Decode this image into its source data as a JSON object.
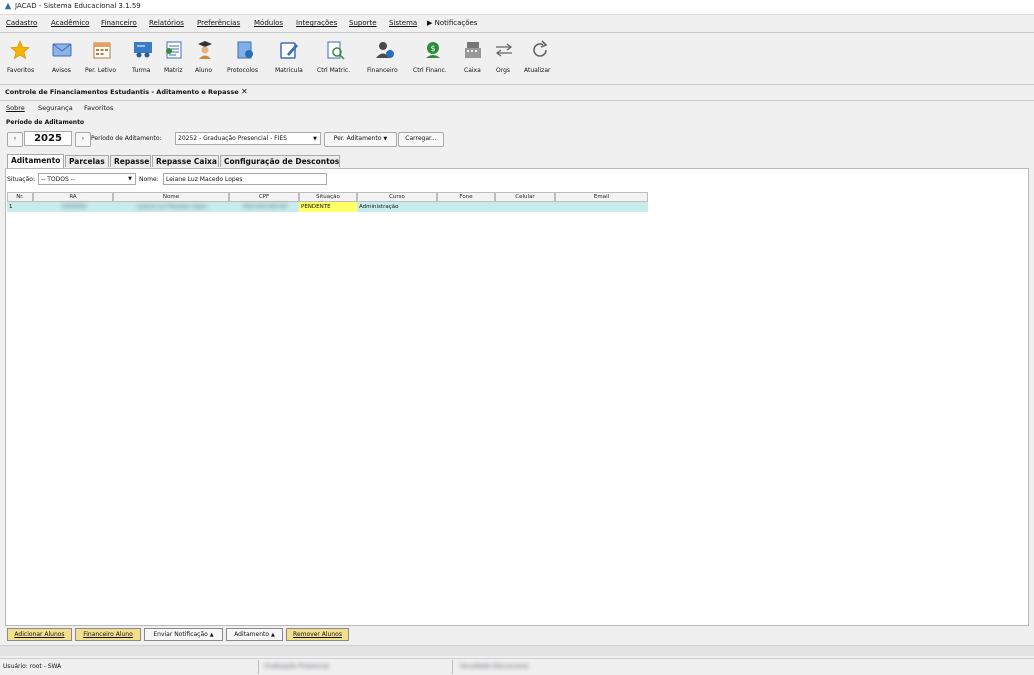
{
  "window": {
    "title": "JACAD - Sistema Educacional 3.1.59"
  },
  "menubar": {
    "items": [
      "Cadastro",
      "Acadêmico",
      "Financeiro",
      "Relatórios",
      "Preferências",
      "Módulos",
      "Integrações",
      "Suporte",
      "Sistema",
      "Notificações"
    ]
  },
  "toolbar": {
    "items": [
      "Favoritos",
      "Avisos",
      "Per. Letivo",
      "Turma",
      "Matriz",
      "Aluno",
      "Protocolos",
      "Matricula",
      "Ctrl Matric.",
      "Financeiro",
      "Ctrl Financ.",
      "Caixa",
      "Orgs",
      "Atualizar"
    ]
  },
  "main_tab": {
    "title": "Controle de Financiamentos Estudantis - Aditamento e Repasse",
    "close": "✕"
  },
  "submenu": {
    "items": [
      "Sobre",
      "Segurança",
      "Favoritos"
    ]
  },
  "period": {
    "label": "Período de Aditamento",
    "prev": "‹",
    "year": "2025",
    "next": "›",
    "periodo_label": "Período de Aditamento:",
    "periodo_value": "20252 - Graduação Presencial - FIES",
    "per_button": "Per. Aditamento",
    "carregar": "Carregar..."
  },
  "tabs": [
    "Aditamento",
    "Parcelas",
    "Repasse",
    "Repasse Caixa",
    "Configuração de Descontos"
  ],
  "filters": {
    "situacao_label": "Situação:",
    "situacao_value": "-- TODOS --",
    "nome_label": "Nome:",
    "nome_value": "Leiane Luz Macedo Lopes"
  },
  "grid": {
    "columns": [
      "Nr.",
      "RA",
      "Nome",
      "CPF",
      "Situação",
      "Curso",
      "Fone",
      "Celular",
      "Email"
    ],
    "rows": [
      {
        "nr": "1",
        "ra": "0000000",
        "nome": "Leiane Luz Macedo Lopes",
        "cpf": "000.000.000-00",
        "situacao": "PENDENTE",
        "curso": "Administração",
        "fone": "",
        "celular": "",
        "email": ""
      }
    ]
  },
  "bottom_buttons": [
    "Adicionar Alunos",
    "Financeiro Aluno",
    "Enviar Notificação",
    "Aditamento",
    "Remover Alunos"
  ],
  "statusbar": {
    "user": "Usuário: root - SWA",
    "unit": "Graduação Presencial",
    "institution": "Faculdade Educacional"
  },
  "colors": {
    "selected_row": "#c8ecec",
    "pending": "#ffff66",
    "button_highlight": "#f2e08c"
  }
}
